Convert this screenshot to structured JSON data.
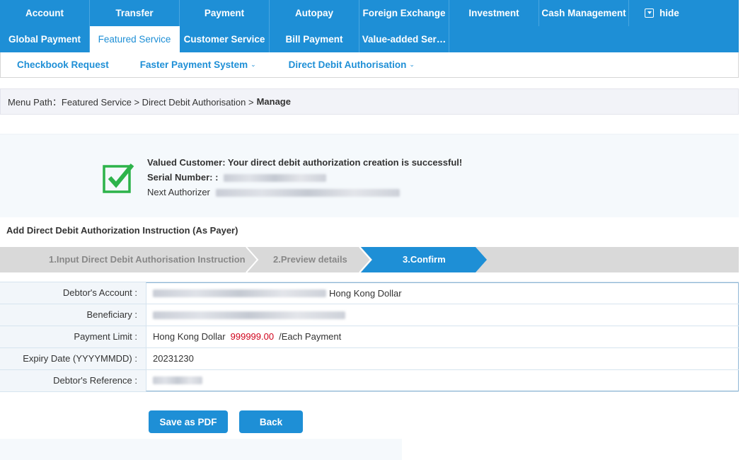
{
  "nav_row1": [
    "Account",
    "Transfer",
    "Payment",
    "Autopay",
    "Foreign Exchange",
    "Investment",
    "Cash Management"
  ],
  "nav_hide_label": "hide",
  "nav_row2": [
    "Global Payment",
    "Featured Service",
    "Customer Service",
    "Bill Payment",
    "Value-added Ser…"
  ],
  "nav_row2_active": "Featured Service",
  "subnav": {
    "checkbook": "Checkbook Request",
    "fps": "Faster Payment System",
    "dda": "Direct Debit Authorisation"
  },
  "breadcrumb": {
    "path": "Menu Path：Featured Service > Direct Debit Authorisation >",
    "current": "Manage"
  },
  "success": {
    "message": "Valued Customer: Your direct debit authorization creation is successful!",
    "serial_label": "Serial Number: :",
    "next_authorizer_label": "Next Authorizer"
  },
  "section_title": "Add Direct Debit Authorization Instruction (As Payer)",
  "steps": [
    {
      "label": "1.Input Direct Debit Authorisation Instruction",
      "state": "done"
    },
    {
      "label": "2.Preview details",
      "state": "done"
    },
    {
      "label": "3.Confirm",
      "state": "active"
    }
  ],
  "colors": {
    "accent": "#1e8fd6",
    "step_inactive": "#d9d9d9",
    "limit_red": "#d0021b",
    "check_green": "#2db34a"
  },
  "details": {
    "debtor_account_label": "Debtor's Account :",
    "debtor_account_currency": "Hong Kong Dollar",
    "beneficiary_label": "Beneficiary :",
    "payment_limit_label": "Payment Limit :",
    "payment_limit_currency": "Hong Kong Dollar",
    "payment_limit_amount": "999999.00",
    "payment_limit_suffix": "/Each Payment",
    "expiry_label": "Expiry Date (YYYYMMDD) :",
    "expiry_value": "20231230",
    "reference_label": "Debtor's Reference :"
  },
  "buttons": {
    "save_pdf": "Save as PDF",
    "back": "Back"
  }
}
